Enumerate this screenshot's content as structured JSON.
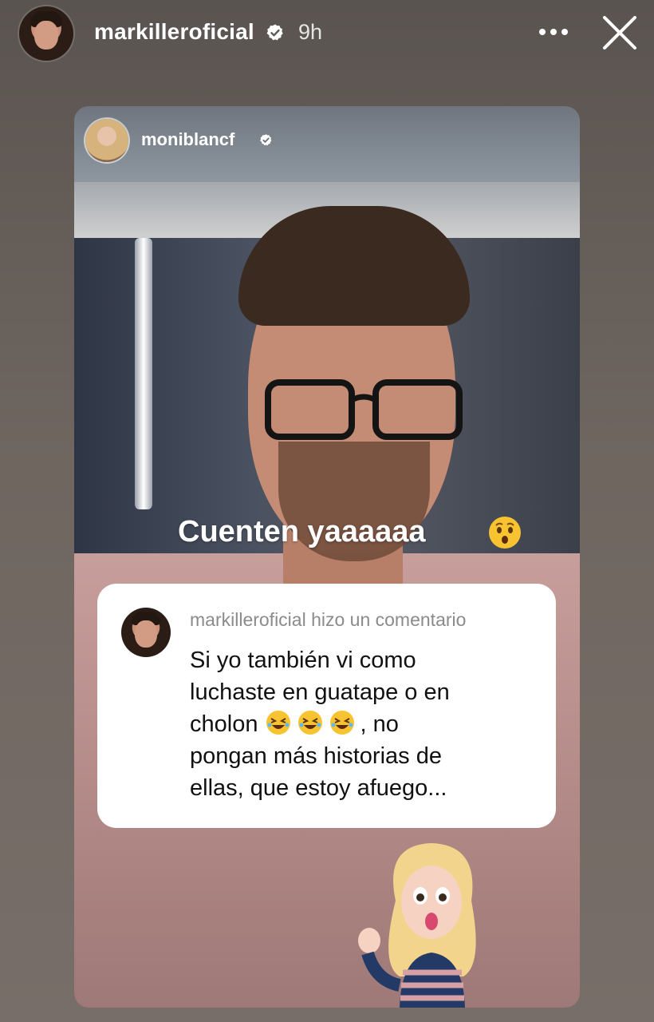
{
  "header": {
    "username": "markilleroficial",
    "time": "9h"
  },
  "story": {
    "shared_username": "moniblancf",
    "caption": "Cuenten yaaaaaa",
    "caption_emoji": "astonished-face",
    "comment": {
      "header": "markilleroficial hizo un comentario",
      "lines": [
        "Si yo también vi como",
        "luchaste en guatape o en",
        "cholon",
        ", no",
        "pongan más historias de",
        "ellas, que estoy afuego..."
      ],
      "inline_emoji": "rolling-on-the-floor-laughing",
      "inline_emoji_count": 3
    },
    "sticker": "avatar-sticker-surprised"
  },
  "icons": {
    "verified": "verified-badge-icon",
    "more": "more-dots-icon",
    "close": "close-icon"
  },
  "colors": {
    "verified_blue": "#ffffff",
    "comment_card": "#ffffff"
  }
}
